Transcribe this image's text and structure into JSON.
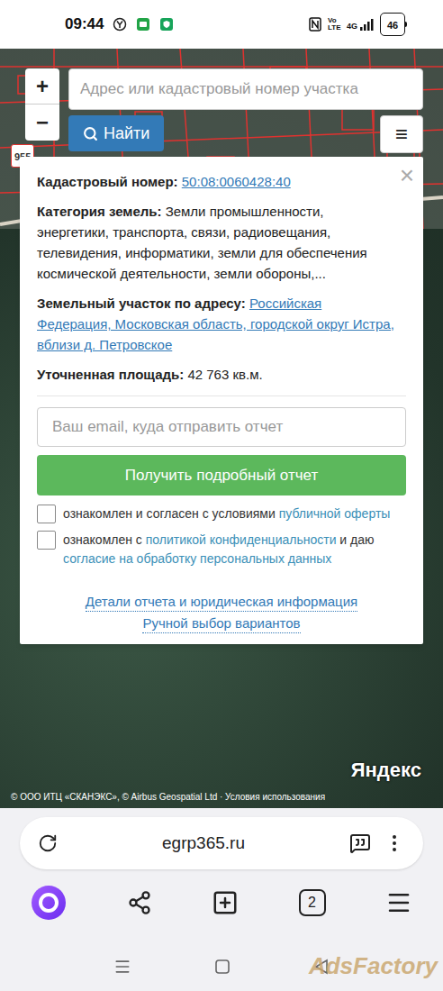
{
  "status_bar": {
    "time": "09:44",
    "volte": "Vo LTE",
    "network": "4G",
    "battery": "46"
  },
  "map": {
    "zoom_in": "+",
    "zoom_out": "−",
    "search_placeholder": "Адрес или кадастровый номер участка",
    "search_button": "Найти",
    "menu_button": "≡",
    "road_label": "955",
    "brand": "Яндекс",
    "attribution": "© ООО ИТЦ «СКАНЭКС», © Airbus Geospatial Ltd · Условия использования"
  },
  "popup": {
    "close": "×",
    "fields": [
      {
        "label": "Кадастровый номер:",
        "value": "50:08:0060428:40",
        "link": true
      },
      {
        "label": "Категория земель:",
        "value": "Земли промышленности, энергетики, транспорта, связи, радиовещания, телевидения, информатики, земли для обеспечения космической деятельности, земли обороны,...",
        "link": false
      },
      {
        "label": "Земельный участок по адресу:",
        "value": "Российская Федерация, Московская область, городской округ Истра, вблизи д. Петровское",
        "link": true
      },
      {
        "label": "Уточненная площадь:",
        "value": "42 763 кв.м.",
        "link": false
      }
    ],
    "email_placeholder": "Ваш email, куда отправить отчет",
    "submit_button": "Получить подробный отчет",
    "consents": [
      {
        "checked": false,
        "parts": [
          {
            "text": "ознакомлен и согласен с условиями ",
            "link": false
          },
          {
            "text": "публичной оферты",
            "link": true
          }
        ]
      },
      {
        "checked": false,
        "parts": [
          {
            "text": "ознакомлен с ",
            "link": false
          },
          {
            "text": "политикой конфиденциальности",
            "link": true
          },
          {
            "text": " и даю ",
            "link": false
          },
          {
            "text": "согласие на обработку персональных данных",
            "link": true
          }
        ]
      }
    ],
    "footer_links": [
      "Детали отчета и юридическая информация",
      "Ручной выбор вариантов"
    ]
  },
  "browser": {
    "url": "egrp365.ru",
    "tab_count": "2"
  },
  "watermark": "AdsFactory"
}
